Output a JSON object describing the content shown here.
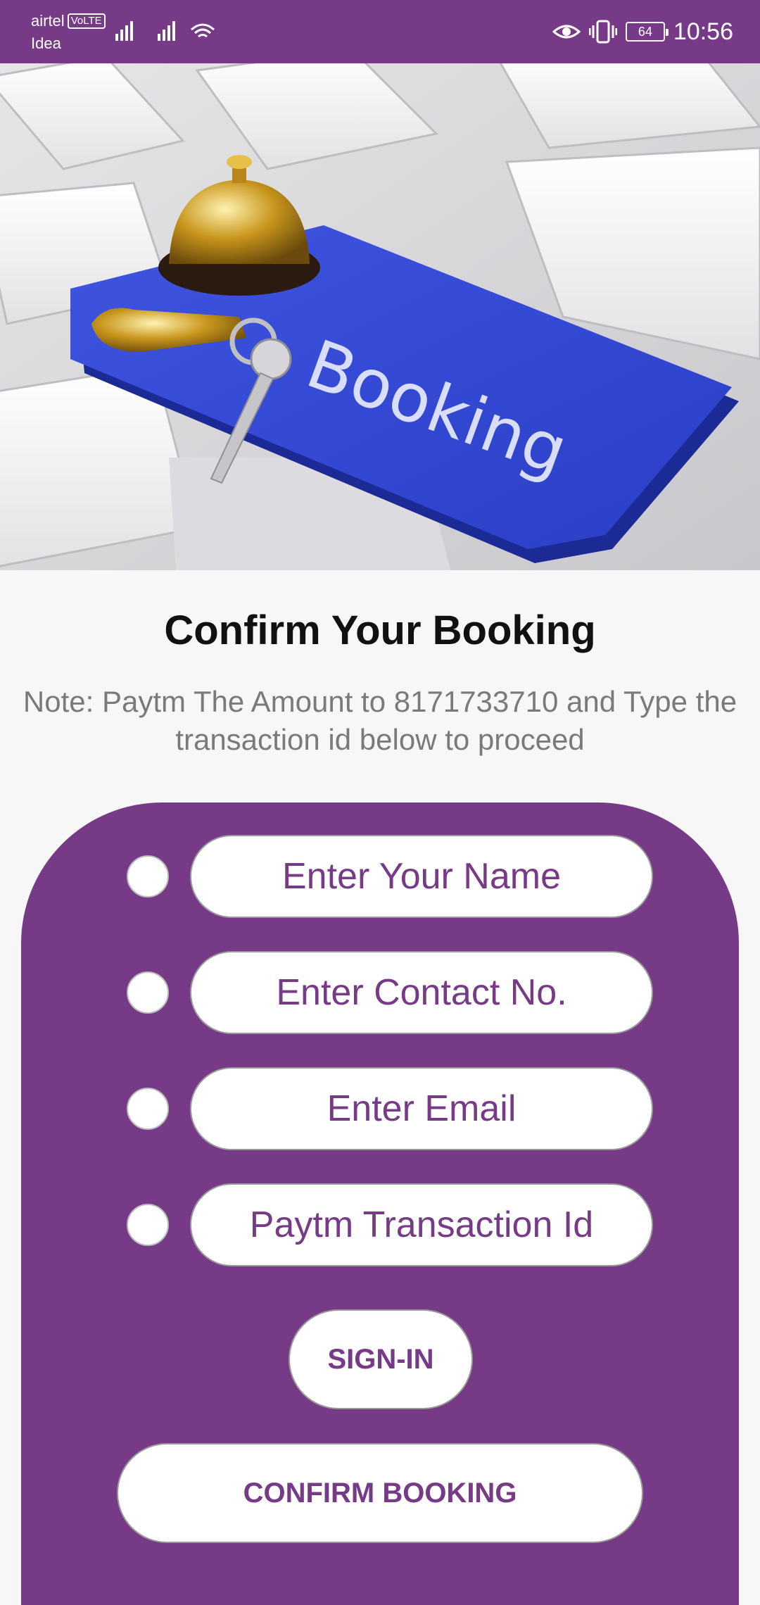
{
  "status_bar": {
    "carrier_1": "airtel",
    "volte_badge": "VoLTE",
    "carrier_2": "Idea",
    "battery_level": "64",
    "time": "10:56",
    "icons": [
      "signal-icon",
      "wifi-icon",
      "eye-icon",
      "vibrate-icon",
      "battery-icon"
    ]
  },
  "hero": {
    "image_alt": "Booking"
  },
  "page": {
    "title": "Confirm Your Booking",
    "note": "Note: Paytm The Amount to 8171733710 and Type the transaction id below to proceed"
  },
  "form": {
    "name_placeholder": "Enter Your Name",
    "contact_placeholder": "Enter Contact No.",
    "email_placeholder": "Enter Email",
    "transaction_placeholder": "Paytm Transaction Id",
    "signin_label": "SIGN-IN",
    "confirm_label": "CONFIRM BOOKING"
  },
  "colors": {
    "accent": "#763a86",
    "text_dark": "#111111",
    "text_muted": "#7a7a7a"
  }
}
